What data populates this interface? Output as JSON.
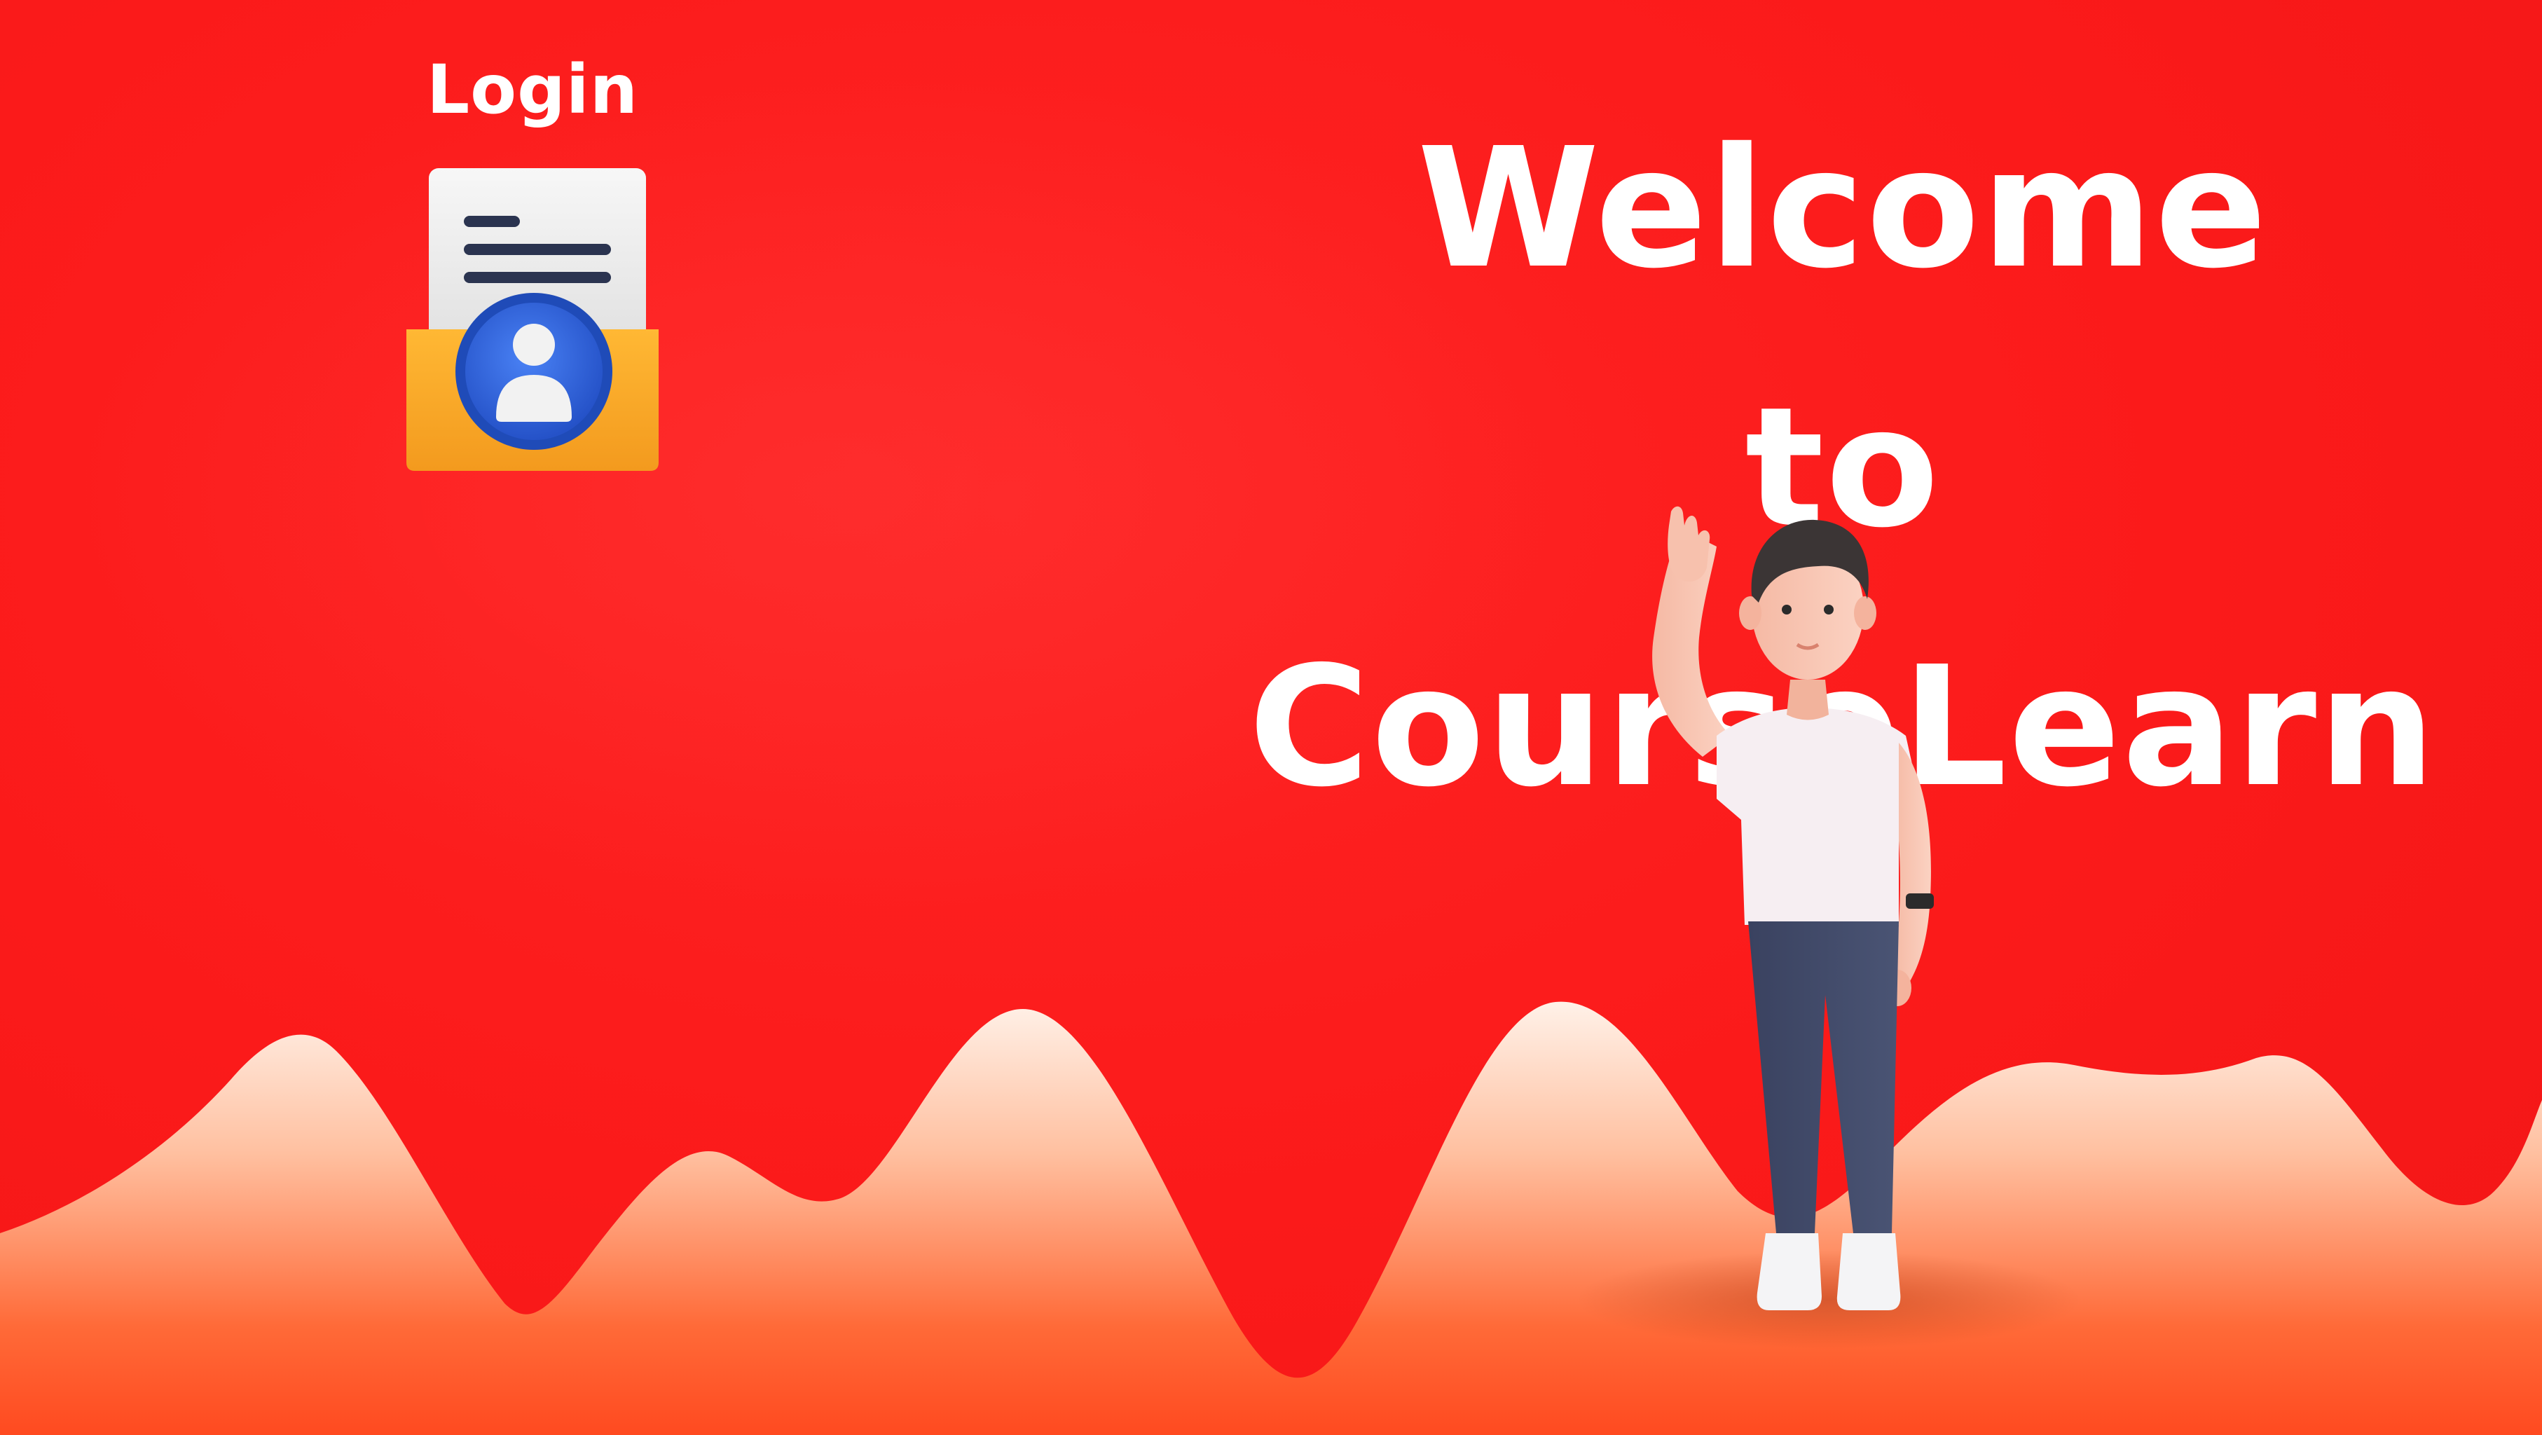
{
  "login": {
    "label": "Login",
    "icon": "login-document-user-icon"
  },
  "headline": {
    "line1": "Welcome",
    "line2": "to",
    "line3": "CourseLearn"
  },
  "illustration": {
    "icon": "waving-person-illustration"
  },
  "colors": {
    "background": "#ff1c1c",
    "text": "#ffffff",
    "wave_light": "#ffe4d8",
    "wave_dark": "#ff5a2a",
    "folder": "#f7a928",
    "badge": "#2f63e0",
    "document": "#f1f1f1",
    "document_lines": "#2b3450"
  }
}
